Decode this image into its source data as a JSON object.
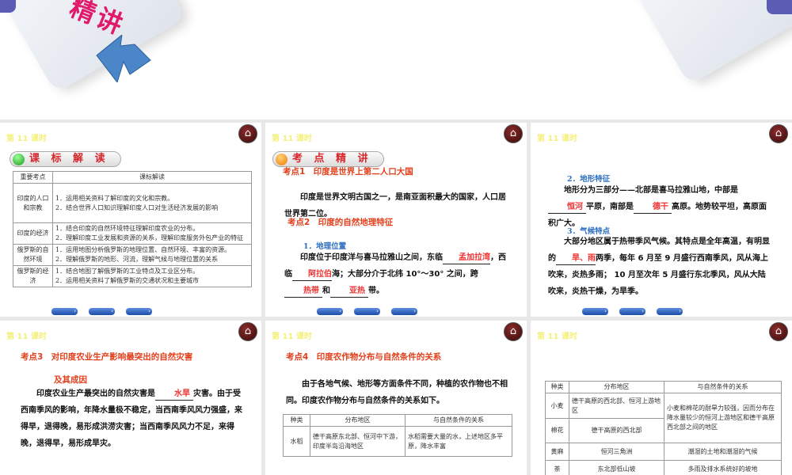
{
  "banner": {
    "title_fragment": "精讲"
  },
  "lesson_label": "第 11 课时",
  "home_icon": "home-icon",
  "slide1": {
    "badge": "课 标 解 读",
    "table": {
      "headers": [
        "重要考点",
        "课标解读"
      ],
      "rows": [
        {
          "topic": "印度的人口和宗教",
          "items": [
            "1．运用相关资料了解印度的文化和宗教。",
            "2．结合世界人口知识理解印度人口对生活经济发展的影响"
          ]
        },
        {
          "topic": "印度的经济",
          "items": [
            "1．结合印度的自然环境特征理解印度农业的分布。",
            "2．理解印度工业发展和资源的关系，理解印度服务外包产业的特征"
          ]
        },
        {
          "topic": "俄罗斯的自然环境",
          "items": [
            "1．运用地图分析俄罗斯的地理位置、自然环境、丰富的资源。",
            "2．理解俄罗斯的地形、河流，理解气候与地理位置的关系"
          ]
        },
        {
          "topic": "俄罗斯的经济",
          "items": [
            "1．结合地图了解俄罗斯的工业特点及工业区分布。",
            "2．运用相关资料了解俄罗斯的交通状况和主要城市"
          ]
        }
      ]
    }
  },
  "slide2": {
    "badge": "考 点 精 讲",
    "k1": "考点1　印度是世界上第二人口大国",
    "p1": "印度是世界文明古国之一，是南亚面积最大的国家，人口居世界第二位。",
    "k2": "考点2　印度的自然地理特征",
    "sub1": "1．地理位置",
    "p2a": "印度位于印度洋与喜马拉雅山之间，东临",
    "b1": "孟加拉湾",
    "p2b": "，西临",
    "b2": "阿拉伯",
    "p2c": "海；大部分介于北纬 10°～30° 之间，跨",
    "b3": "热带",
    "p2d": "和",
    "b4": "亚热",
    "p2e": "带。"
  },
  "slide3": {
    "sub2": "2．地形特征",
    "p1a": "地形分为三部分——北部是喜马拉雅山地，中部是",
    "b1": "恒河",
    "p1b": "平原，南部是",
    "b2": "德干",
    "p1c": "高原。地势较平坦，高原面积广大。",
    "sub3": "3．气候特点",
    "p2a": "大部分地区属于热带季风气候。其特点是全年高温，有明显的",
    "b3": "旱、雨",
    "p2b": "两季，每年 6 月至 9 月盛行西南季风，风从海上吹来，炎热多雨； 10 月至次年 5 月盛行东北季风，风从大陆吹来，炎热干燥，为旱季。"
  },
  "slide4": {
    "k3a": "考点3　对印度农业生产影响最突出的自然灾害",
    "k3b": "及其成因",
    "p1a": "印度农业生产最突出的自然灾害是",
    "b1": "水旱",
    "p1b": "灾害。由于受西南季风的影响，年降水量极不稳定，当西南季风风力强盛，来得早，退得晚，易形成洪涝灾害；当西南季风风力不足，来得晚，退得早，易形成旱灾。"
  },
  "slide5": {
    "k4": "考点4　印度农作物分布与自然条件的关系",
    "p1": "由于各地气候、地形等方面条件不同，种植的农作物也不相同。印度农作物分布与自然条件的关系如下。",
    "table": {
      "headers": [
        "种类",
        "分布地区",
        "与自然条件的关系"
      ],
      "rows": [
        [
          "水稻",
          "德干高原东北部、恒河中下游，印度半岛沿海地区",
          "水稻需要大量的水，上述地区多平原，降水丰富"
        ]
      ]
    }
  },
  "slide6": {
    "table": {
      "headers": [
        "种类",
        "分布地区",
        "与自然条件的关系"
      ],
      "rows": [
        [
          "小麦",
          "德干高原的西北部、恒河上游地区"
        ],
        [
          "棉花",
          "德干高原的西北部"
        ],
        [
          "黄麻",
          "恒河三角洲",
          "潮湿的土地和潮湿的气候"
        ],
        [
          "茶",
          "东北部低山坡",
          "多雨及排水系统好的坡地"
        ]
      ],
      "merged": "小麦和棉花的耐旱力较强，因而分布在降水量较少的恒河上游地区和德干高原西北部之间的地区"
    }
  },
  "colors": {
    "red": "#e2401c",
    "blue": "#2e6fc0",
    "lesson": "#f4f07a"
  }
}
